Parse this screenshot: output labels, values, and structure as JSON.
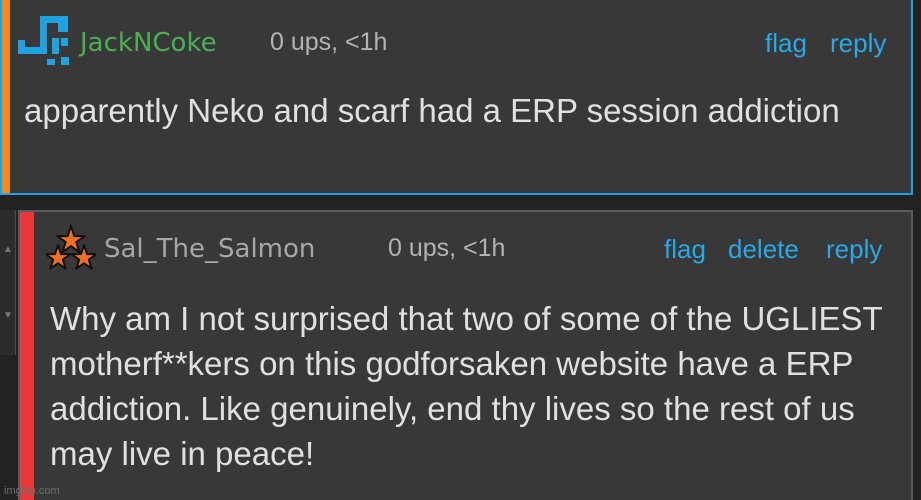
{
  "comments": [
    {
      "username": "JackNCoke",
      "meta": "0 ups, <1h",
      "actions": [
        "flag",
        "reply"
      ],
      "text": "apparently Neko and scarf had a ERP session addiction",
      "colors": {
        "accent": "#f7891c",
        "border": "#1fa3e0",
        "username": "#4caf50"
      },
      "avatar_icon": "blocky-pixel-logo-icon"
    },
    {
      "username": "Sal_The_Salmon",
      "meta": "0 ups, <1h",
      "actions": [
        "flag",
        "delete",
        "reply"
      ],
      "text": "Why am I not surprised that two of some of the UGLIEST motherf**kers on this godforsaken website have a ERP addiction. Like genuinely, end thy lives so the rest of us may live in peace!",
      "colors": {
        "accent": "#e8383a",
        "border": "#5a5a5a",
        "username": "#a6a6a6"
      },
      "avatar_icon": "three-stars-icon"
    }
  ],
  "colors": {
    "background": "#222222",
    "card": "#383838",
    "action_link": "#28a8e6",
    "meta": "#b3b3b3",
    "text": "#e0e0e0"
  },
  "watermark": "imgflip.com"
}
